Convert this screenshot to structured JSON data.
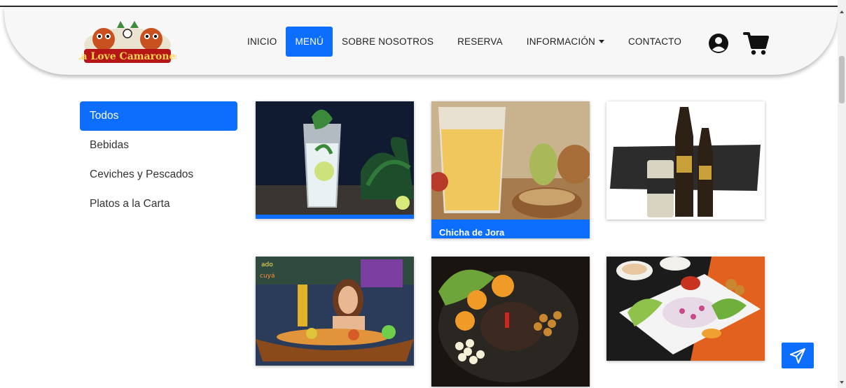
{
  "header": {
    "logo_text": "La Love Camarones",
    "nav": [
      {
        "label": "INICIO"
      },
      {
        "label": "MENÚ"
      },
      {
        "label": "SOBRE NOSOTROS"
      },
      {
        "label": "RESERVA"
      },
      {
        "label": "INFORMACIÓN"
      },
      {
        "label": "CONTACTO"
      }
    ],
    "active_nav": "MENÚ"
  },
  "sidebar": {
    "items": [
      {
        "label": "Todos"
      },
      {
        "label": "Bebidas"
      },
      {
        "label": "Ceviches y Pescados"
      },
      {
        "label": "Platos a la Carta"
      }
    ],
    "active": "Todos"
  },
  "products": [
    {
      "label": ""
    },
    {
      "label": "Chicha de Jora"
    },
    {
      "label": ""
    },
    {
      "label": ""
    },
    {
      "label": ""
    },
    {
      "label": ""
    }
  ],
  "colors": {
    "accent": "#0d6efd",
    "header_bg": "#f7f7f8"
  },
  "icons": {
    "user": "user-circle-icon",
    "cart": "shopping-cart-icon",
    "send": "paper-plane-icon"
  }
}
